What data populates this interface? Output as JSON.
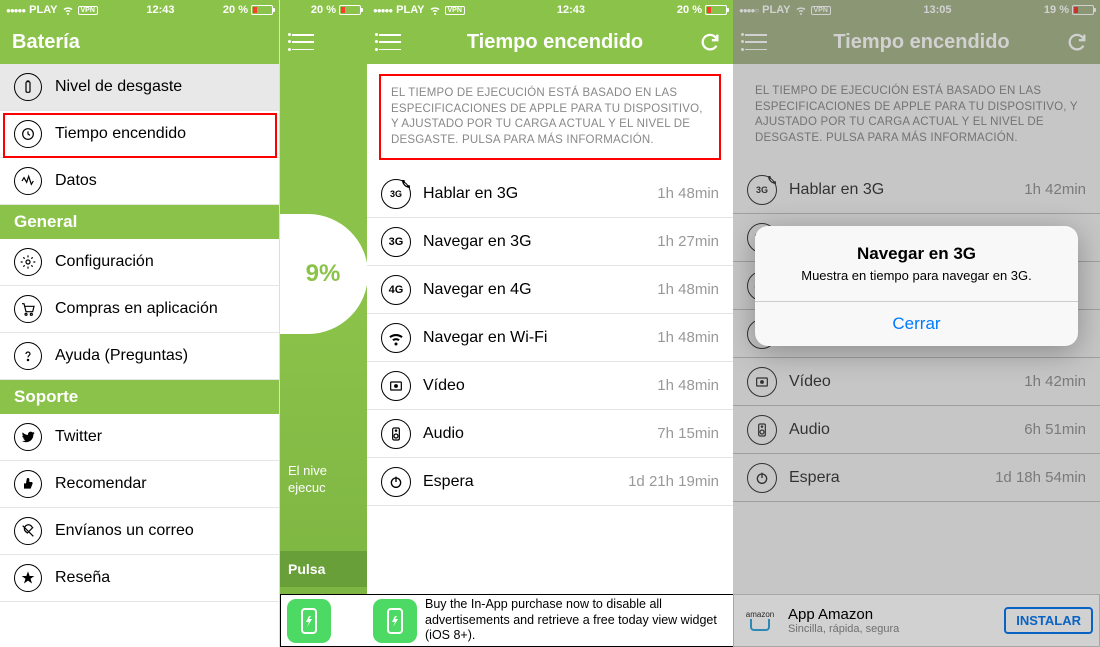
{
  "status": {
    "carrier": "PLAY",
    "vpn": "VPN",
    "time1": "12:43",
    "time3": "13:05",
    "batt1": "20 %",
    "batt3": "19 %"
  },
  "shot1": {
    "title": "Batería",
    "sections": [
      {
        "header": null,
        "items": [
          {
            "label": "Nivel de desgaste",
            "name": "wear-level",
            "selected": true
          },
          {
            "label": "Tiempo encendido",
            "name": "runtime",
            "highlight": true
          },
          {
            "label": "Datos",
            "name": "data"
          }
        ]
      },
      {
        "header": "General",
        "items": [
          {
            "label": "Configuración",
            "name": "settings"
          },
          {
            "label": "Compras en aplicación",
            "name": "iap"
          },
          {
            "label": "Ayuda (Preguntas)",
            "name": "help"
          }
        ]
      },
      {
        "header": "Soporte",
        "items": [
          {
            "label": "Twitter",
            "name": "twitter"
          },
          {
            "label": "Recomendar",
            "name": "recommend"
          },
          {
            "label": "Envíanos un correo",
            "name": "mail"
          },
          {
            "label": "Reseña",
            "name": "review"
          }
        ]
      }
    ]
  },
  "peek": {
    "pct": "9%",
    "line1": "El nive",
    "line2": "ejecuc",
    "btn": "Pulsa"
  },
  "shot2": {
    "title": "Tiempo encendido",
    "info": "EL TIEMPO DE EJECUCIÓN ESTÁ BASADO EN LAS ESPECIFICACIONES DE APPLE PARA TU DISPOSITIVO, Y AJUSTADO POR TU CARGA ACTUAL Y EL NIVEL DE DESGASTE. PULSA PARA MÁS INFORMACIÓN.",
    "rows": [
      {
        "icon": "talk3g",
        "label": "Hablar en 3G",
        "val": "1h 48min"
      },
      {
        "icon": "3g",
        "label": "Navegar en 3G",
        "val": "1h 27min"
      },
      {
        "icon": "4g",
        "label": "Navegar en 4G",
        "val": "1h 48min"
      },
      {
        "icon": "wifi",
        "label": "Navegar en Wi-Fi",
        "val": "1h 48min"
      },
      {
        "icon": "video",
        "label": "Vídeo",
        "val": "1h 48min"
      },
      {
        "icon": "audio",
        "label": "Audio",
        "val": "7h 15min"
      },
      {
        "icon": "standby",
        "label": "Espera",
        "val": "1d 21h 19min"
      }
    ],
    "ad": "Buy the In-App purchase now to disable all advertisements and retrieve a free today view widget (iOS 8+)."
  },
  "shot3": {
    "title": "Tiempo encendido",
    "info": "EL TIEMPO DE EJECUCIÓN ESTÁ BASADO EN LAS ESPECIFICACIONES DE APPLE PARA TU DISPOSITIVO, Y AJUSTADO POR TU CARGA ACTUAL Y EL NIVEL DE DESGASTE. PULSA PARA MÁS INFORMACIÓN.",
    "rows": [
      {
        "icon": "talk3g",
        "label": "Hablar en 3G",
        "val": "1h 42min"
      },
      {
        "icon": "3g",
        "label": "",
        "val": ""
      },
      {
        "icon": "4g",
        "label": "",
        "val": ""
      },
      {
        "icon": "wifi",
        "label": "",
        "val": ""
      },
      {
        "icon": "video",
        "label": "Vídeo",
        "val": "1h 42min"
      },
      {
        "icon": "audio",
        "label": "Audio",
        "val": "6h 51min"
      },
      {
        "icon": "standby",
        "label": "Espera",
        "val": "1d 18h 54min"
      }
    ],
    "alert": {
      "title": "Navegar en 3G",
      "msg": "Muestra en tiempo para navegar en 3G.",
      "btn": "Cerrar"
    },
    "ad": {
      "title": "App Amazon",
      "sub": "Sincilla, rápida, segura",
      "btn": "INSTALAR",
      "brand": "amazon"
    }
  }
}
